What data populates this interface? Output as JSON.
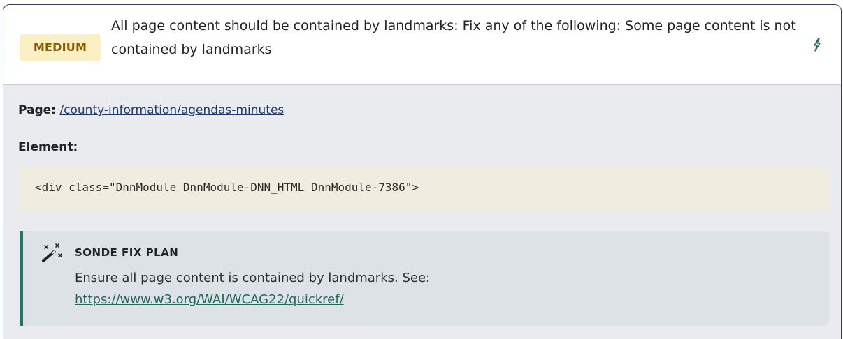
{
  "issue": {
    "severity": "MEDIUM",
    "title": "All page content should be contained by landmarks: Fix any of the following: Some page content is not contained by landmarks",
    "action_icon": "bolt-icon"
  },
  "details": {
    "page_label": "Page:",
    "page_url": "/county-information/agendas-minutes",
    "element_label": "Element:",
    "element_code": "<div class=\"DnnModule DnnModule-DNN_HTML DnnModule-7386\">"
  },
  "fix_plan": {
    "icon": "magic-wand-icon",
    "heading": "SONDE FIX PLAN",
    "text": "Ensure all page content is contained by landmarks. See:",
    "link": "https://www.w3.org/WAI/WCAG22/quickref/"
  },
  "colors": {
    "badge_bg": "#fbefc4",
    "badge_text": "#8a5a00",
    "accent": "#2e6f63",
    "link": "#1f3a6a"
  }
}
